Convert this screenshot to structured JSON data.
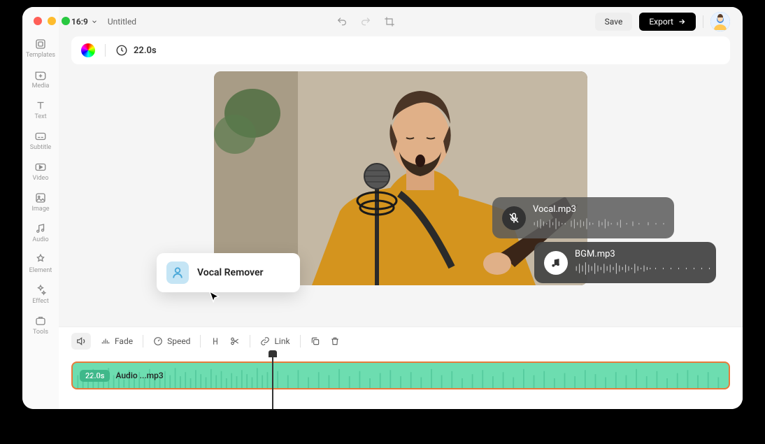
{
  "window": {
    "traffic_colors": [
      "#ff5f57",
      "#febc2e",
      "#28c840"
    ]
  },
  "sidebar": {
    "items": [
      {
        "label": "Templates"
      },
      {
        "label": "Media"
      },
      {
        "label": "Text"
      },
      {
        "label": "Subtitle"
      },
      {
        "label": "Video"
      },
      {
        "label": "Image"
      },
      {
        "label": "Audio"
      },
      {
        "label": "Element"
      },
      {
        "label": "Effect"
      },
      {
        "label": "Tools"
      }
    ]
  },
  "header": {
    "aspect_ratio": "16:9",
    "project_title": "Untitled",
    "save_label": "Save",
    "export_label": "Export"
  },
  "info": {
    "duration": "22.0s"
  },
  "popup": {
    "label": "Vocal Remover"
  },
  "chips": {
    "vocal": {
      "label": "Vocal.mp3"
    },
    "bgm": {
      "label": "BGM.mp3"
    }
  },
  "toolbar": {
    "fade": "Fade",
    "speed": "Speed",
    "link": "Link"
  },
  "track": {
    "time_badge": "22.0s",
    "file_name": "Audio ...mp3"
  }
}
